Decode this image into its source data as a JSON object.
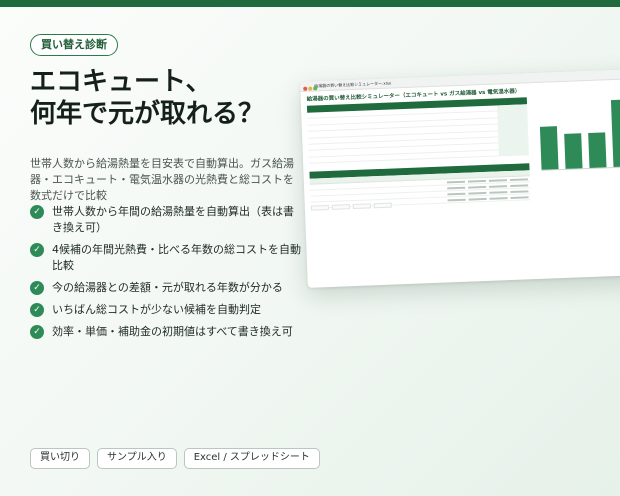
{
  "tag": "買い替え診断",
  "title_line1": "エコキュート、",
  "title_line2": "何年で元が取れる？",
  "description": "世帯人数から給湯熱量を目安表で自動算出。ガス給湯器・エコキュート・電気温水器の光熱費と総コストを数式だけで比較",
  "features": [
    "世帯人数から年間の給湯熱量を自動算出（表は書き換え可）",
    "4候補の年間光熱費・比べる年数の総コストを自動比較",
    "今の給湯器との差額・元が取れる年数が分かる",
    "いちばん総コストが少ない候補を自動判定",
    "効率・単価・補助金の初期値はすべて書き換え可"
  ],
  "pills": [
    "買い切り",
    "サンプル入り",
    "Excel / スプレッドシート"
  ],
  "preview": {
    "file_name": "給湯器の買い替え比較シミュレーター.xlsx",
    "sheet_title": "給湯器の買い替え比較シミュレーター（エコキュート vs ガス給湯器 vs 電気温水器）",
    "chart_bar_levels": [
      0.62,
      0.5,
      0.5,
      0.96
    ]
  },
  "colors": {
    "accent": "#1f6b3e",
    "bar": "#2e8b57"
  }
}
